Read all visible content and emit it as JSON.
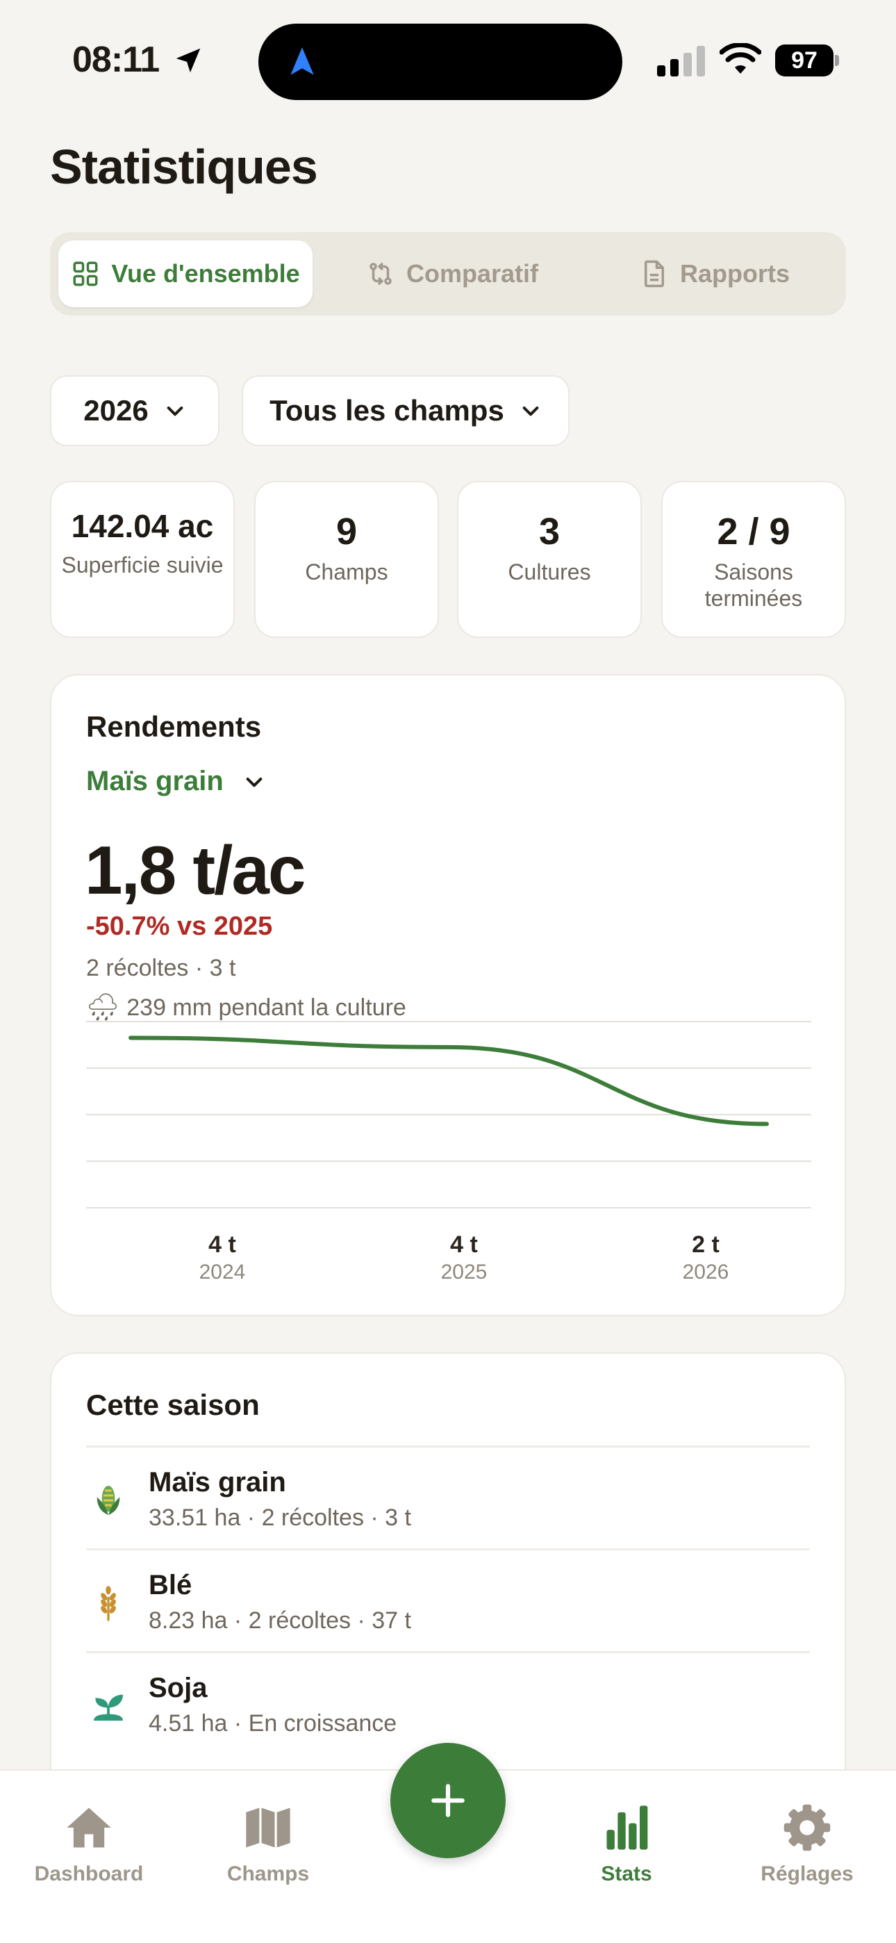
{
  "status": {
    "time": "08:11",
    "battery": "97"
  },
  "page_title": "Statistiques",
  "tabs": [
    {
      "label": "Vue d'ensemble",
      "icon": "grid-icon",
      "active": true
    },
    {
      "label": "Comparatif",
      "icon": "compare-icon",
      "active": false
    },
    {
      "label": "Rapports",
      "icon": "document-icon",
      "active": false
    }
  ],
  "filters": {
    "year": "2026",
    "fields": "Tous les champs"
  },
  "stats": [
    {
      "value": "142.04 ac",
      "label": "Superficie suivie"
    },
    {
      "value": "9",
      "label": "Champs"
    },
    {
      "value": "3",
      "label": "Cultures"
    },
    {
      "value": "2 / 9",
      "label": "Saisons terminées"
    }
  ],
  "yields": {
    "title": "Rendements",
    "crop": "Maïs grain",
    "value": "1,8 t/ac",
    "delta": "-50.7% vs 2025",
    "harvests": "2 récoltes · 3 t",
    "rain": "239 mm pendant la culture"
  },
  "chart_data": {
    "type": "line",
    "categories": [
      "2024",
      "2025",
      "2026"
    ],
    "value_labels": [
      "4 t",
      "4 t",
      "2 t"
    ],
    "values": [
      3.65,
      3.45,
      1.8
    ],
    "ylim": [
      0,
      4
    ],
    "grid": true,
    "color": "#3d7d3a"
  },
  "season": {
    "title": "Cette saison",
    "items": [
      {
        "name": "Maïs grain",
        "detail": "33.51 ha · 2 récoltes · 3 t",
        "icon": "corn-icon"
      },
      {
        "name": "Blé",
        "detail": "8.23 ha · 2 récoltes · 37 t",
        "icon": "wheat-icon"
      },
      {
        "name": "Soja",
        "detail": "4.51 ha · En croissance",
        "icon": "sprout-icon"
      }
    ]
  },
  "tabbar": {
    "dashboard": "Dashboard",
    "champs": "Champs",
    "stats": "Stats",
    "reglages": "Réglages"
  },
  "colors": {
    "accent": "#3d7d3a",
    "negative": "#b02a24",
    "background": "#f5f4f0"
  }
}
